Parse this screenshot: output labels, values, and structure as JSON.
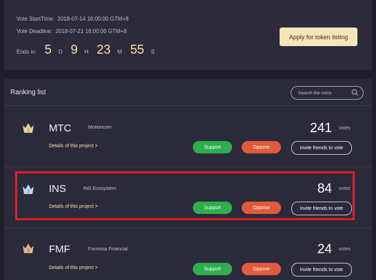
{
  "vote_info": {
    "start_label": "Vote StartTime:",
    "start_value": "2018-07-14 16:00:00 GTM+8",
    "deadline_label": "Vote Deadline:",
    "deadline_value": "2018-07-21 16:00:00 GTM+8",
    "ends_label": "Ends in:",
    "countdown": {
      "days": "5",
      "days_unit": "D",
      "hours": "9",
      "hours_unit": "H",
      "minutes": "23",
      "minutes_unit": "M",
      "seconds": "55",
      "seconds_unit": "S"
    },
    "apply_button": "Apply for token listing"
  },
  "ranking": {
    "title": "Ranking list",
    "search_placeholder": "Search the coins",
    "projects": [
      {
        "rank": "1",
        "symbol": "MTC",
        "name": "Motioncoin",
        "details": "Details of this project >",
        "votes": "241",
        "votes_label": "votes",
        "support": "Support",
        "oppose": "Oppose",
        "invite": "Invite friends to vote",
        "crown_color": "#e8cfa0"
      },
      {
        "rank": "2",
        "symbol": "INS",
        "name": "INS Ecosystem",
        "details": "Details of this project >",
        "votes": "84",
        "votes_label": "votes",
        "support": "Support",
        "oppose": "Oppose",
        "invite": "Invite friends to vote",
        "crown_color": "#bcd6f4"
      },
      {
        "rank": "3",
        "symbol": "FMF",
        "name": "Formosa Financial",
        "details": "Details of this project >",
        "votes": "24",
        "votes_label": "votes",
        "support": "Support",
        "oppose": "Oppose",
        "invite": "Invite friends to vote",
        "crown_color": "#dbb58c"
      }
    ]
  },
  "colors": {
    "highlight": "#e31d25",
    "support": "#2fae4e",
    "oppose": "#e05a3b",
    "accent": "#f4e6b9"
  }
}
